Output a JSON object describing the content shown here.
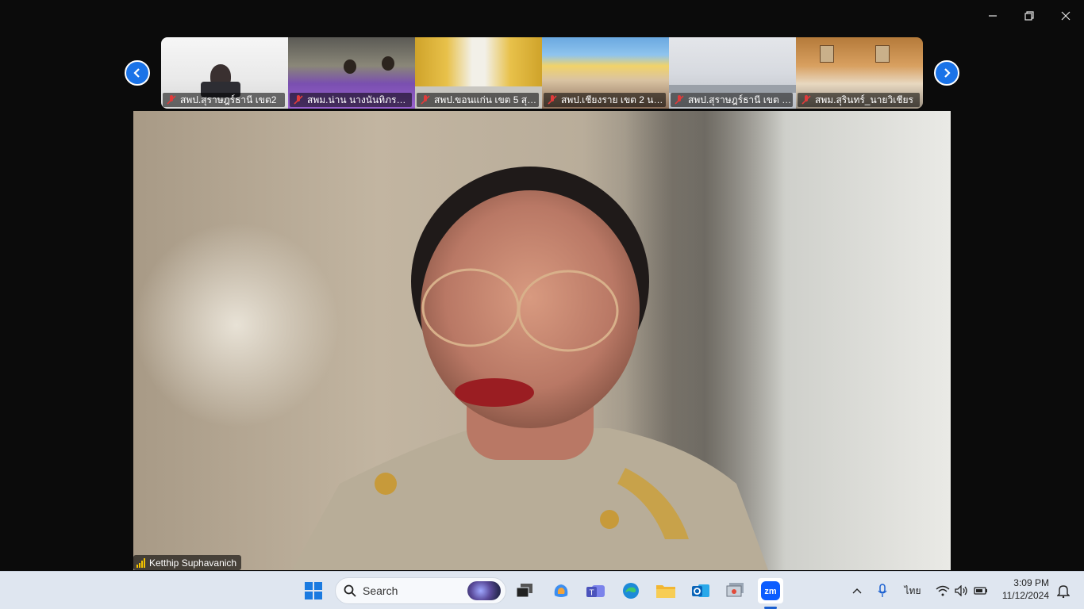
{
  "window": {
    "controls": [
      "minimize",
      "restore",
      "close"
    ]
  },
  "gallery": {
    "prev_icon": "chevron-left-icon",
    "next_icon": "chevron-right-icon",
    "participants": [
      {
        "name": "สพป.สุราษฎร์ธานี เขต2",
        "muted": true
      },
      {
        "name": "สพม.น่าน นางนันทิภรณ์ ...",
        "muted": true
      },
      {
        "name": "สพป.ขอนแก่น เขต 5 สุระ...",
        "muted": true
      },
      {
        "name": "สพป.เชียงราย เขต 2 นาย...",
        "muted": true
      },
      {
        "name": "สพป.สุราษฎร์ธานี เขต 1_...",
        "muted": true
      },
      {
        "name": "สพม.สุรินทร์_นายวิเชียร",
        "muted": true
      }
    ]
  },
  "active_speaker": {
    "name": "Ketthip Suphavanich",
    "signal_icon": "signal-bars-icon"
  },
  "taskbar": {
    "search_placeholder": "Search",
    "apps": [
      "start-icon",
      "search-icon",
      "task-view-icon",
      "copilot-icon",
      "teams-icon",
      "edge-icon",
      "file-explorer-icon",
      "outlook-icon",
      "remote-desktop-icon",
      "zoom-icon"
    ],
    "active_app": "zoom-icon",
    "tray": {
      "language": "ไทย"
    },
    "time": "3:09 PM",
    "date": "11/12/2024"
  }
}
